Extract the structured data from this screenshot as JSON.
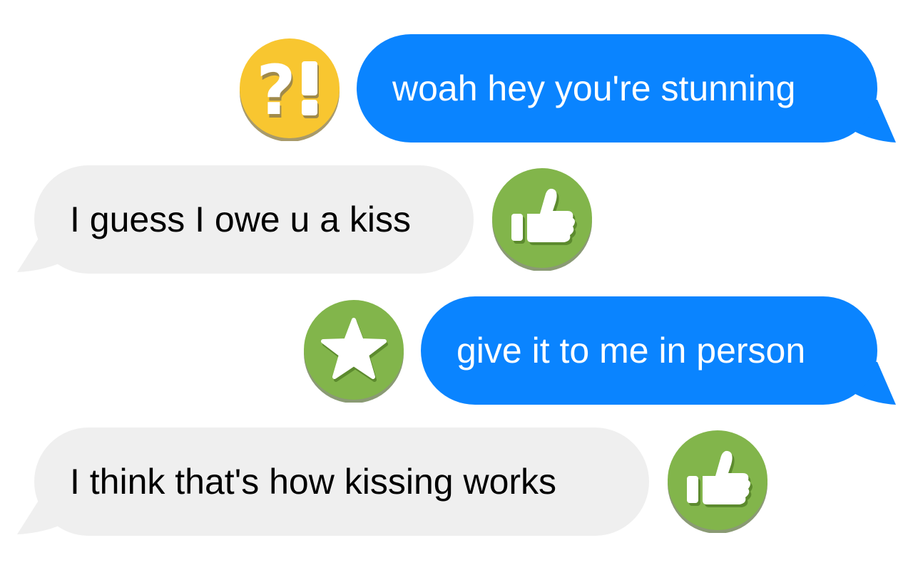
{
  "colors": {
    "outgoing_bubble": "#0a84ff",
    "incoming_bubble": "#efefef",
    "question_reaction": "#f8c630",
    "green_reaction": "#82b54b"
  },
  "messages": [
    {
      "direction": "outgoing",
      "text": "woah hey you're stunning",
      "reaction": "question-exclamation-icon"
    },
    {
      "direction": "incoming",
      "text": "I guess I owe u a kiss",
      "reaction": "thumbs-up-icon"
    },
    {
      "direction": "outgoing",
      "text": "give it to me in person",
      "reaction": "star-icon"
    },
    {
      "direction": "incoming",
      "text": "I think that's how kissing works",
      "reaction": "thumbs-up-icon"
    }
  ]
}
